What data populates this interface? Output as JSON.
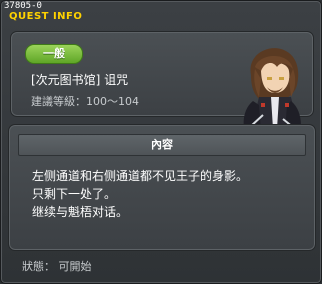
{
  "window": {
    "quest_id": "37805-0",
    "title": "QUEST INFO"
  },
  "quest": {
    "category_tag": "一般",
    "name": "[次元图书馆] 诅咒",
    "level_range": "建議等級：100～104",
    "npc": "npc-portrait"
  },
  "content": {
    "header": "內容",
    "lines": [
      "左侧通道和右侧通道都不见王子的身影。",
      "只剩下一处了。",
      "继续与魁梧对话。"
    ]
  },
  "status": "狀態： 可開始",
  "colors": {
    "title": "#ffd200",
    "tag_green": "#7cc043",
    "background": "#3a3e41"
  }
}
